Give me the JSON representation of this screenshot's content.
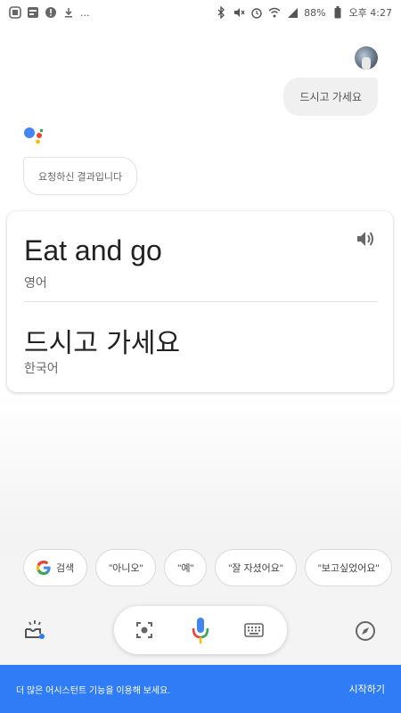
{
  "status_bar": {
    "left_icons": [
      "ux-icon",
      "notification-icon",
      "alert-icon",
      "download-icon"
    ],
    "ellipsis": "...",
    "battery_pct": "88%",
    "time": "오후 4:27"
  },
  "conversation": {
    "user_query": "드시고 가세요",
    "assistant_reply": "요청하신 결과입니다"
  },
  "translation_card": {
    "source_text": "Eat and go",
    "source_lang": "영어",
    "target_text": "드시고 가세요",
    "target_lang": "한국어"
  },
  "suggestions": [
    {
      "label": "검색",
      "icon": "google-icon"
    },
    {
      "label": "\"아니오\""
    },
    {
      "label": "\"예\""
    },
    {
      "label": "\"잘 자셨어요\""
    },
    {
      "label": "\"보고싶었어요\""
    }
  ],
  "controls": {
    "left": "lens-icon",
    "camera": "camera-icon",
    "mic": "mic-icon",
    "keyboard": "keyboard-icon",
    "right": "compass-icon"
  },
  "banner": {
    "text": "더 많은 어시스턴트 기능을 이용해 보세요.",
    "action": "시작하기"
  },
  "colors": {
    "accent": "#2f7cf6",
    "google_blue": "#4285f4",
    "google_red": "#ea4335",
    "google_yellow": "#fbbc05",
    "google_green": "#34a853"
  }
}
